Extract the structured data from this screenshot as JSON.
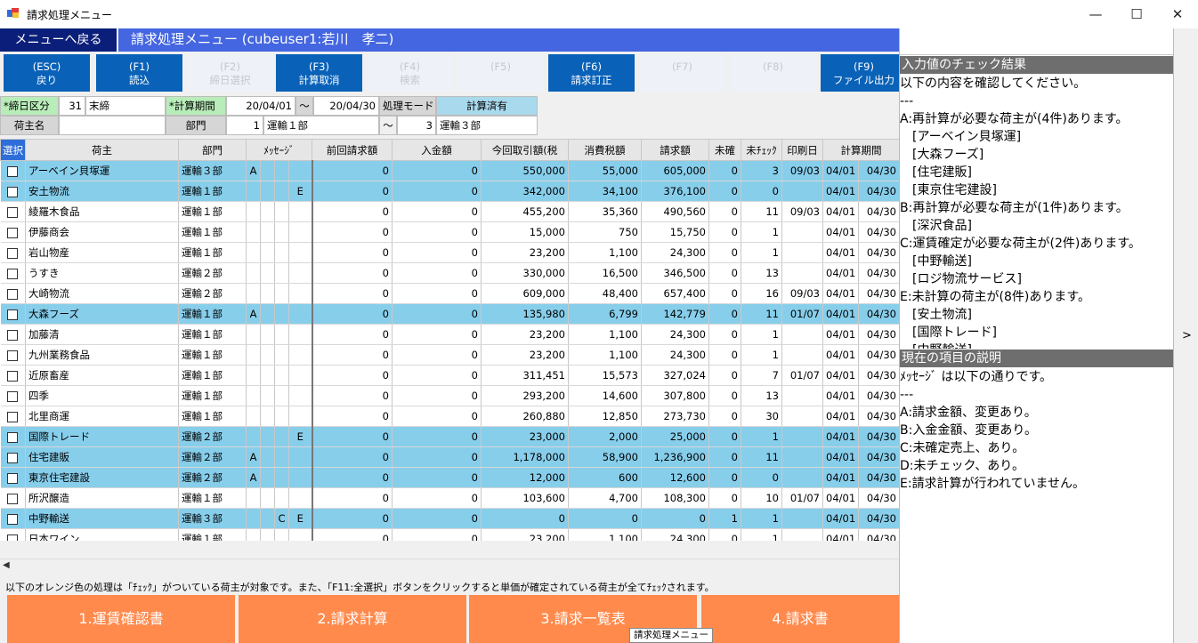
{
  "window": {
    "title": "請求処理メニュー"
  },
  "header": {
    "back_button": "メニューへ戻る",
    "screen_title": "請求処理メニュー (cubeuser1:若川　孝二)"
  },
  "fkeys": [
    {
      "key": "(ESC)",
      "label": "戻り",
      "enabled": true
    },
    {
      "key": "(F1)",
      "label": "読込",
      "enabled": true
    },
    {
      "key": "(F2)",
      "label": "締日選択",
      "enabled": false
    },
    {
      "key": "(F3)",
      "label": "計算取消",
      "enabled": true
    },
    {
      "key": "(F4)",
      "label": "検索",
      "enabled": false
    },
    {
      "key": "(F5)",
      "label": "",
      "enabled": false
    },
    {
      "key": "(F6)",
      "label": "請求訂正",
      "enabled": true
    },
    {
      "key": "(F7)",
      "label": "",
      "enabled": false
    },
    {
      "key": "(F8)",
      "label": "",
      "enabled": false
    },
    {
      "key": "(F9)",
      "label": "ファイル出力",
      "enabled": true
    }
  ],
  "conditions": {
    "closing_label": "*締日区分",
    "closing_code": "31",
    "closing_name": "末締",
    "period_label": "*計算期間",
    "period_from": "20/04/01",
    "period_sep": "～",
    "period_to": "20/04/30",
    "mode_label": "処理モード",
    "mode_value": "計算済有",
    "shipper_label": "荷主名",
    "shipper_value": "",
    "dept_label": "部門",
    "dept_from_code": "1",
    "dept_from_name": "運輸１部",
    "dept_sep": "～",
    "dept_to_code": "3",
    "dept_to_name": "運輸３部"
  },
  "grid": {
    "columns": [
      "選択",
      "荷主",
      "部門",
      "ﾒｯｾｰｼﾞ",
      "前回請求額",
      "入金額",
      "今回取引額(税",
      "消費税額",
      "請求額",
      "未確",
      "未ﾁｪｯｸ",
      "印刷日",
      "計算期間"
    ],
    "rows": [
      {
        "hl": true,
        "name": "アーベイン貝塚運",
        "dept": "運輸３部",
        "m": [
          "A",
          "",
          "",
          ""
        ],
        "prev": "0",
        "paid": "0",
        "amount": "550,000",
        "tax": "55,000",
        "bill": "605,000",
        "unconf": "0",
        "uncheck": "3",
        "printed": "09/03",
        "from": "04/01",
        "to": "04/30"
      },
      {
        "hl": true,
        "name": "安土物流",
        "dept": "運輸１部",
        "m": [
          "",
          "",
          "",
          "E"
        ],
        "prev": "0",
        "paid": "0",
        "amount": "342,000",
        "tax": "34,100",
        "bill": "376,100",
        "unconf": "0",
        "uncheck": "0",
        "printed": "",
        "from": "04/01",
        "to": "04/30"
      },
      {
        "hl": false,
        "name": "綾羅木食品",
        "dept": "運輸１部",
        "m": [
          "",
          "",
          "",
          ""
        ],
        "prev": "0",
        "paid": "0",
        "amount": "455,200",
        "tax": "35,360",
        "bill": "490,560",
        "unconf": "0",
        "uncheck": "11",
        "printed": "09/03",
        "from": "04/01",
        "to": "04/30"
      },
      {
        "hl": false,
        "name": "伊藤商会",
        "dept": "運輸１部",
        "m": [
          "",
          "",
          "",
          ""
        ],
        "prev": "0",
        "paid": "0",
        "amount": "15,000",
        "tax": "750",
        "bill": "15,750",
        "unconf": "0",
        "uncheck": "1",
        "printed": "",
        "from": "04/01",
        "to": "04/30"
      },
      {
        "hl": false,
        "name": "岩山物産",
        "dept": "運輸１部",
        "m": [
          "",
          "",
          "",
          ""
        ],
        "prev": "0",
        "paid": "0",
        "amount": "23,200",
        "tax": "1,100",
        "bill": "24,300",
        "unconf": "0",
        "uncheck": "1",
        "printed": "",
        "from": "04/01",
        "to": "04/30"
      },
      {
        "hl": false,
        "name": "うすき",
        "dept": "運輸２部",
        "m": [
          "",
          "",
          "",
          ""
        ],
        "prev": "0",
        "paid": "0",
        "amount": "330,000",
        "tax": "16,500",
        "bill": "346,500",
        "unconf": "0",
        "uncheck": "13",
        "printed": "",
        "from": "04/01",
        "to": "04/30"
      },
      {
        "hl": false,
        "name": "大崎物流",
        "dept": "運輸２部",
        "m": [
          "",
          "",
          "",
          ""
        ],
        "prev": "0",
        "paid": "0",
        "amount": "609,000",
        "tax": "48,400",
        "bill": "657,400",
        "unconf": "0",
        "uncheck": "16",
        "printed": "09/03",
        "from": "04/01",
        "to": "04/30"
      },
      {
        "hl": true,
        "name": "大森フーズ",
        "dept": "運輸１部",
        "m": [
          "A",
          "",
          "",
          ""
        ],
        "prev": "0",
        "paid": "0",
        "amount": "135,980",
        "tax": "6,799",
        "bill": "142,779",
        "unconf": "0",
        "uncheck": "11",
        "printed": "01/07",
        "from": "04/01",
        "to": "04/30"
      },
      {
        "hl": false,
        "name": "加藤清",
        "dept": "運輸１部",
        "m": [
          "",
          "",
          "",
          ""
        ],
        "prev": "0",
        "paid": "0",
        "amount": "23,200",
        "tax": "1,100",
        "bill": "24,300",
        "unconf": "0",
        "uncheck": "1",
        "printed": "",
        "from": "04/01",
        "to": "04/30"
      },
      {
        "hl": false,
        "name": "九州業務食品",
        "dept": "運輸１部",
        "m": [
          "",
          "",
          "",
          ""
        ],
        "prev": "0",
        "paid": "0",
        "amount": "23,200",
        "tax": "1,100",
        "bill": "24,300",
        "unconf": "0",
        "uncheck": "1",
        "printed": "",
        "from": "04/01",
        "to": "04/30"
      },
      {
        "hl": false,
        "name": "近原畜産",
        "dept": "運輸１部",
        "m": [
          "",
          "",
          "",
          ""
        ],
        "prev": "0",
        "paid": "0",
        "amount": "311,451",
        "tax": "15,573",
        "bill": "327,024",
        "unconf": "0",
        "uncheck": "7",
        "printed": "01/07",
        "from": "04/01",
        "to": "04/30"
      },
      {
        "hl": false,
        "name": "四季",
        "dept": "運輸１部",
        "m": [
          "",
          "",
          "",
          ""
        ],
        "prev": "0",
        "paid": "0",
        "amount": "293,200",
        "tax": "14,600",
        "bill": "307,800",
        "unconf": "0",
        "uncheck": "13",
        "printed": "",
        "from": "04/01",
        "to": "04/30"
      },
      {
        "hl": false,
        "name": "北里商運",
        "dept": "運輸１部",
        "m": [
          "",
          "",
          "",
          ""
        ],
        "prev": "0",
        "paid": "0",
        "amount": "260,880",
        "tax": "12,850",
        "bill": "273,730",
        "unconf": "0",
        "uncheck": "30",
        "printed": "",
        "from": "04/01",
        "to": "04/30"
      },
      {
        "hl": true,
        "name": "国際トレード",
        "dept": "運輸２部",
        "m": [
          "",
          "",
          "",
          "E"
        ],
        "prev": "0",
        "paid": "0",
        "amount": "23,000",
        "tax": "2,000",
        "bill": "25,000",
        "unconf": "0",
        "uncheck": "1",
        "printed": "",
        "from": "04/01",
        "to": "04/30"
      },
      {
        "hl": true,
        "name": "住宅建販",
        "dept": "運輸２部",
        "m": [
          "A",
          "",
          "",
          ""
        ],
        "prev": "0",
        "paid": "0",
        "amount": "1,178,000",
        "tax": "58,900",
        "bill": "1,236,900",
        "unconf": "0",
        "uncheck": "11",
        "printed": "",
        "from": "04/01",
        "to": "04/30"
      },
      {
        "hl": true,
        "name": "東京住宅建設",
        "dept": "運輸２部",
        "m": [
          "A",
          "",
          "",
          ""
        ],
        "prev": "0",
        "paid": "0",
        "amount": "12,000",
        "tax": "600",
        "bill": "12,600",
        "unconf": "0",
        "uncheck": "0",
        "printed": "",
        "from": "04/01",
        "to": "04/30"
      },
      {
        "hl": false,
        "name": "所沢醸造",
        "dept": "運輸１部",
        "m": [
          "",
          "",
          "",
          ""
        ],
        "prev": "0",
        "paid": "0",
        "amount": "103,600",
        "tax": "4,700",
        "bill": "108,300",
        "unconf": "0",
        "uncheck": "10",
        "printed": "01/07",
        "from": "04/01",
        "to": "04/30"
      },
      {
        "hl": true,
        "name": "中野輸送",
        "dept": "運輸３部",
        "m": [
          "",
          "",
          "C",
          "E"
        ],
        "prev": "0",
        "paid": "0",
        "amount": "0",
        "tax": "0",
        "bill": "0",
        "unconf": "1",
        "uncheck": "1",
        "printed": "",
        "from": "04/01",
        "to": "04/30"
      },
      {
        "hl": false,
        "name": "日本ワイン",
        "dept": "運輸１部",
        "m": [
          "",
          "",
          "",
          ""
        ],
        "prev": "0",
        "paid": "0",
        "amount": "23,200",
        "tax": "1,100",
        "bill": "24,300",
        "unconf": "0",
        "uncheck": "1",
        "printed": "",
        "from": "04/01",
        "to": "04/30"
      }
    ]
  },
  "footer": {
    "note": "以下のオレンジ色の処理は「ﾁｪｯｸ」がついている荷主が対象です。また、「F11:全選択」ボタンをクリックすると単価が確定されている荷主が全てﾁｪｯｸされます。",
    "actions": [
      "1.運賃確認書",
      "2.請求計算",
      "3.請求一覧表",
      "4.請求書"
    ],
    "action_color": "#ff8a4c",
    "tooltip": "請求処理メニュー"
  },
  "panel": {
    "check_title": "入力値のチェック結果",
    "check_lines": [
      "以下の内容を確認してください。",
      "---",
      "A:再計算が必要な荷主が(4件)あります。",
      "　[アーベイン貝塚運]",
      "　[大森フーズ]",
      "　[住宅建販]",
      "　[東京住宅建設]",
      "B:再計算が必要な荷主が(1件)あります。",
      "　[深沢食品]",
      "C:運賃確定が必要な荷主が(2件)あります。",
      "　[中野輸送]",
      "　[ロジ物流サービス]",
      "E:未計算の荷主が(8件)あります。",
      "　[安土物流]",
      "　[国際トレード]",
      "　[中野輸送]"
    ],
    "desc_title": "現在の項目の説明",
    "desc_lines": [
      "ﾒｯｾｰｼﾞ は以下の通りです。",
      "---",
      "A:請求金額、変更あり。",
      "B:入金金額、変更あり。",
      "C:未確定売上、あり。",
      "D:未チェック、あり。",
      "E:請求計算が行われていません。"
    ],
    "expander": ">"
  },
  "colors": {
    "header_blue": "#4466e0",
    "fkey_blue": "#0a62b8",
    "row_highlight": "#87ceeb",
    "panel_header": "#6e6e6e"
  }
}
